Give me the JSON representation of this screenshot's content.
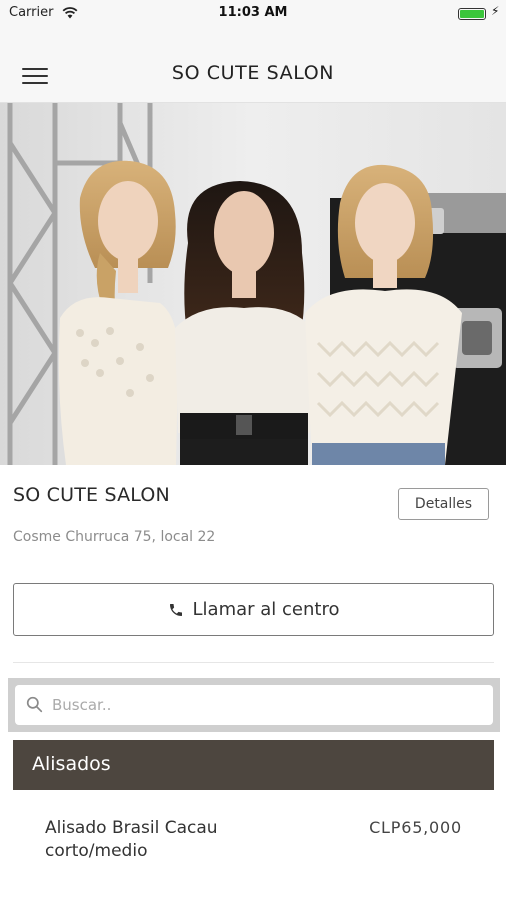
{
  "status_bar": {
    "carrier": "Carrier",
    "time": "11:03 AM",
    "battery_level": 1.0,
    "battery_color": "#3bc63b"
  },
  "header": {
    "title": "SO CUTE SALON",
    "menu_icon": "hamburger-menu-icon"
  },
  "salon": {
    "name": "SO CUTE SALON",
    "address": "Cosme Churruca 75, local 22",
    "details_label": "Detalles",
    "call_label": "Llamar al centro",
    "call_icon": "phone-icon"
  },
  "search": {
    "placeholder": "Buscar..",
    "value": "",
    "icon": "search-icon"
  },
  "category": {
    "label": "Alisados",
    "color": "#4d463f"
  },
  "services": [
    {
      "name": "Alisado Brasil Cacau corto/medio",
      "price": "CLP65,000"
    }
  ]
}
